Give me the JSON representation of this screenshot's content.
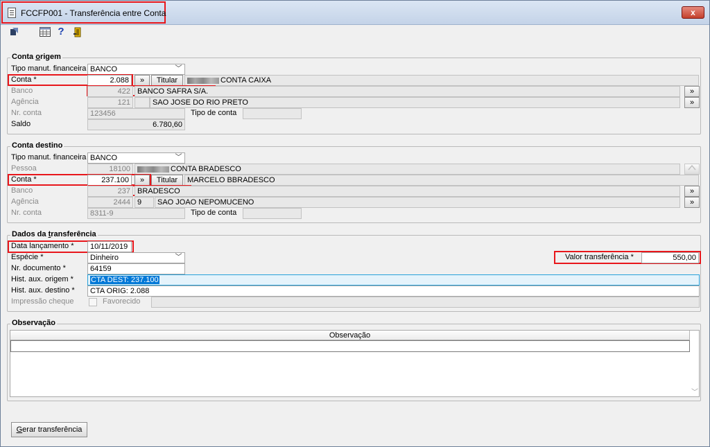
{
  "window": {
    "title": "FCCFP001 - Transferência entre Conta",
    "close": "x"
  },
  "toolbar": {
    "icons": [
      "return-icon",
      "calendar-grid-icon",
      "help-icon",
      "exit-door-icon"
    ],
    "help_glyph": "?"
  },
  "origem": {
    "title_pre": "Conta ",
    "title_u": "o",
    "title_post": "rigem",
    "tipo_label": "Tipo manut. financeira",
    "tipo_value": "BANCO",
    "conta_label": "Conta *",
    "conta_value": "2.088",
    "lookup_btn": "»",
    "titular_label": "Titular",
    "titular_value": "CONTA CAIXA",
    "banco_label": "Banco",
    "banco_code": "422",
    "banco_name": "BANCO SAFRA S/A.",
    "agencia_label": "Agência",
    "agencia_code": "121",
    "agencia_name": "SAO JOSE DO RIO PRETO",
    "nr_label": "Nr. conta",
    "nr_value": "123456",
    "tipo_conta_label": "Tipo de conta",
    "saldo_label": "Saldo",
    "saldo_value": "6.780,60"
  },
  "destino": {
    "title": "Conta destino",
    "tipo_label": "Tipo manut. financeira",
    "tipo_value": "BANCO",
    "pessoa_label": "Pessoa",
    "pessoa_code": "18100",
    "pessoa_name": "CONTA BRADESCO",
    "conta_label": "Conta *",
    "conta_value": "237.100",
    "lookup_btn": "»",
    "titular_label": "Titular",
    "titular_value": "MARCELO  BBRADESCO",
    "banco_label": "Banco",
    "banco_code": "237",
    "banco_name": "BRADESCO",
    "agencia_label": "Agência",
    "agencia_code": "2444",
    "agencia_dv": "9",
    "agencia_name": "SAO JOAO NEPOMUCENO",
    "nr_label": "Nr. conta",
    "nr_value": "8311-9",
    "tipo_conta_label": "Tipo de conta"
  },
  "transferencia": {
    "title_pre": "Dados da ",
    "title_u": "t",
    "title_post": "ransferência",
    "data_label": "Data lançamento *",
    "data_value": "10/11/2019",
    "especie_label": "Espécie *",
    "especie_value": "Dinheiro",
    "valor_label": "Valor transferência *",
    "valor_value": "550,00",
    "nrdoc_label": "Nr. documento *",
    "nrdoc_value": "64159",
    "hist_origem_label": "Hist. aux. origem *",
    "hist_origem_value": "CTA DEST: 237.100",
    "hist_destino_label": "Hist. aux. destino *",
    "hist_destino_value": "CTA ORIG: 2.088",
    "impressao_label": "Impressão cheque",
    "favorecido_label": "Favorecido"
  },
  "observacao": {
    "title": "Observação",
    "column_header": "Observação"
  },
  "footer": {
    "gerar_u": "G",
    "gerar_rest": "erar transferência"
  }
}
